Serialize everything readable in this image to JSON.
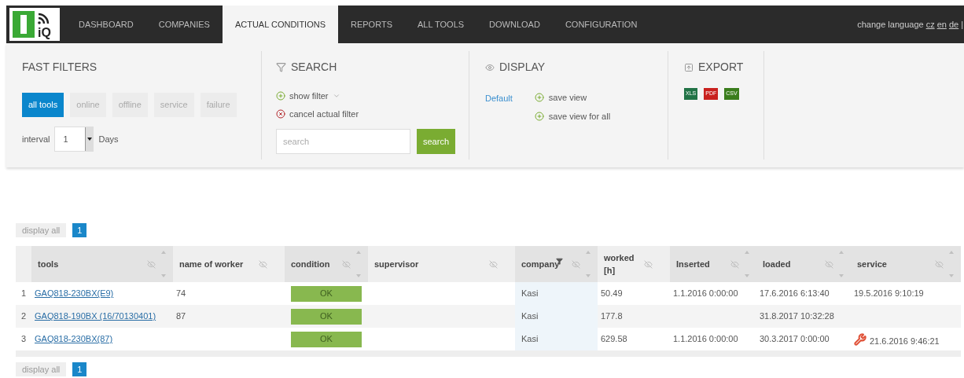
{
  "logo": {
    "text": "iQ"
  },
  "nav": [
    {
      "label": "DASHBOARD",
      "selected": false
    },
    {
      "label": "COMPANIES",
      "selected": false
    },
    {
      "label": "ACTUAL CONDITIONS",
      "selected": true
    },
    {
      "label": "REPORTS",
      "selected": false
    },
    {
      "label": "ALL TOOLS",
      "selected": false
    },
    {
      "label": "DOWNLOAD",
      "selected": false
    },
    {
      "label": "CONFIGURATION",
      "selected": false
    }
  ],
  "language": {
    "label": "change language",
    "links": [
      "cz",
      "en",
      "de"
    ],
    "separator": "|"
  },
  "fast_filters": {
    "title": "FAST FILTERS",
    "buttons": [
      {
        "label": "all tools",
        "selected": true
      },
      {
        "label": "online",
        "selected": false
      },
      {
        "label": "offline",
        "selected": false
      },
      {
        "label": "service",
        "selected": false
      },
      {
        "label": "failure",
        "selected": false
      }
    ],
    "interval_label": "interval",
    "interval_value": "1",
    "interval_unit": "Days"
  },
  "search": {
    "title": "SEARCH",
    "show_filter": "show filter",
    "cancel_filter": "cancel actual filter",
    "placeholder": "search",
    "button": "search"
  },
  "display": {
    "title": "DISPLAY",
    "default_link": "Default",
    "actions": [
      "save view",
      "save view for all"
    ]
  },
  "export": {
    "title": "EXPORT",
    "formats": [
      {
        "label": "XLS",
        "color": "#217346"
      },
      {
        "label": "PDF",
        "color": "#c9211e"
      },
      {
        "label": "CSV",
        "color": "#3a7d1c"
      }
    ]
  },
  "pagination_top": {
    "display_all": "display all",
    "pages": [
      {
        "label": "1",
        "selected": true
      }
    ]
  },
  "table": {
    "columns": [
      {
        "label": "tools",
        "sortable": true,
        "filtered": false
      },
      {
        "label": "name of worker",
        "sortable": false,
        "filtered": false
      },
      {
        "label": "condition",
        "sortable": true,
        "filtered": false
      },
      {
        "label": "supervisor",
        "sortable": false,
        "filtered": false
      },
      {
        "label": "company",
        "sortable": true,
        "filtered": true
      },
      {
        "label": "worked [h]",
        "sortable": false,
        "filtered": false
      },
      {
        "label": "Inserted",
        "sortable": true,
        "filtered": false
      },
      {
        "label": "loaded",
        "sortable": true,
        "filtered": false
      },
      {
        "label": "service",
        "sortable": true,
        "filtered": false
      }
    ],
    "rows": [
      {
        "index": "1",
        "tool": "GAQ818-230BX(E9)",
        "worker": "74",
        "condition": "OK",
        "company": "Kasi",
        "worked": "50.49",
        "inserted": "1.1.2016 0:00:00",
        "loaded": "17.6.2016 6:13:40",
        "service": "19.5.2016 9:10:19",
        "service_alert": false
      },
      {
        "index": "2",
        "tool": "GAQ818-190BX (16/70130401)",
        "worker": "87",
        "condition": "OK",
        "company": "Kasi",
        "worked": "177.8",
        "loaded": "31.8.2017 10:32:28",
        "service_alert": false
      },
      {
        "index": "3",
        "tool": "GAQ818-230BX(87)",
        "condition": "OK",
        "company": "Kasi",
        "worked": "629.58",
        "inserted": "1.1.2016 0:00:00",
        "loaded": "30.3.2017 0:00:00",
        "service": "21.6.2016 9:46:21",
        "service_alert": true
      }
    ]
  },
  "pagination_bottom": {
    "display_all": "display all",
    "pages": [
      {
        "label": "1",
        "selected": true
      }
    ]
  }
}
